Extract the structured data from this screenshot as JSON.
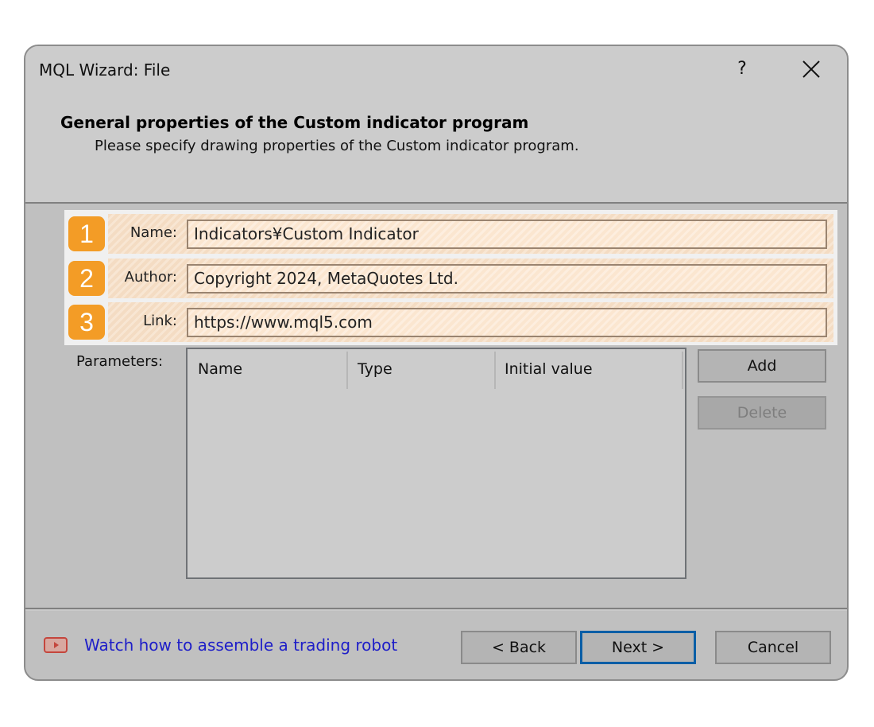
{
  "window": {
    "title": "MQL Wizard: File",
    "help_label": "?",
    "close_icon": "close-icon"
  },
  "header": {
    "heading": "General properties of the Custom indicator program",
    "subheading": "Please specify drawing properties of the Custom indicator program."
  },
  "fields": [
    {
      "badge": "1",
      "label": "Name:",
      "value": "Indicators¥Custom Indicator"
    },
    {
      "badge": "2",
      "label": "Author:",
      "value": "Copyright 2024, MetaQuotes Ltd."
    },
    {
      "badge": "3",
      "label": "Link:",
      "value": "https://www.mql5.com"
    }
  ],
  "parameters": {
    "label": "Parameters:",
    "columns": [
      "Name",
      "Type",
      "Initial value"
    ],
    "rows": [],
    "add_label": "Add",
    "delete_label": "Delete"
  },
  "footer": {
    "video_icon": "video-play-icon",
    "watch_link": "Watch how to assemble a trading robot",
    "back_label": "< Back",
    "next_label": "Next >",
    "cancel_label": "Cancel"
  },
  "colors": {
    "badge": "#f39c26",
    "link": "#1e1ec8",
    "primary_border": "#0a5ea6",
    "header_bg": "#cccccc",
    "body_bg": "#c0c0c0"
  }
}
